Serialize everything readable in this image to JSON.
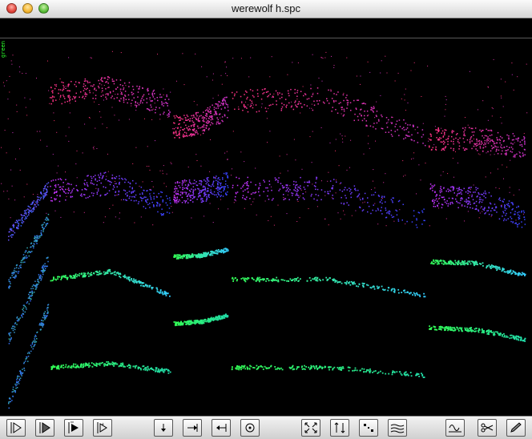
{
  "window": {
    "title": "werewolf h.spc"
  },
  "canvas": {
    "corner_label": "green"
  },
  "spectrogram": {
    "background": "#000000",
    "bands": [
      {
        "color_from": "#ff3380",
        "color_to": "#cc33cc",
        "level": "top"
      },
      {
        "color_from": "#cc33ff",
        "color_to": "#3344ff",
        "level": "upper"
      },
      {
        "color_from": "#33ff55",
        "color_to": "#33ccff",
        "level": "middle"
      },
      {
        "color_from": "#33ff55",
        "color_to": "#22ddaa",
        "level": "lower"
      }
    ]
  },
  "toolbar": {
    "buttons": [
      {
        "name": "play-button",
        "icon": "play-icon"
      },
      {
        "name": "play-selection-button",
        "icon": "play-selection-icon"
      },
      {
        "name": "play-loop-button",
        "icon": "play-loop-icon"
      },
      {
        "name": "play-step-button",
        "icon": "play-step-icon"
      },
      {
        "name": "insert-marker-button",
        "icon": "down-arrow-icon"
      },
      {
        "name": "jump-end-button",
        "icon": "jump-right-icon"
      },
      {
        "name": "jump-start-button",
        "icon": "jump-left-icon"
      },
      {
        "name": "center-button",
        "icon": "target-icon"
      },
      {
        "name": "zoom-fit-button",
        "icon": "expand-icon"
      },
      {
        "name": "transpose-button",
        "icon": "transpose-icon"
      },
      {
        "name": "points-button",
        "icon": "points-icon"
      },
      {
        "name": "wave-view-button",
        "icon": "waveform-icon"
      },
      {
        "name": "sine-button",
        "icon": "sine-icon"
      },
      {
        "name": "split-button",
        "icon": "scissors-icon"
      },
      {
        "name": "pencil-button",
        "icon": "pencil-icon"
      }
    ]
  }
}
